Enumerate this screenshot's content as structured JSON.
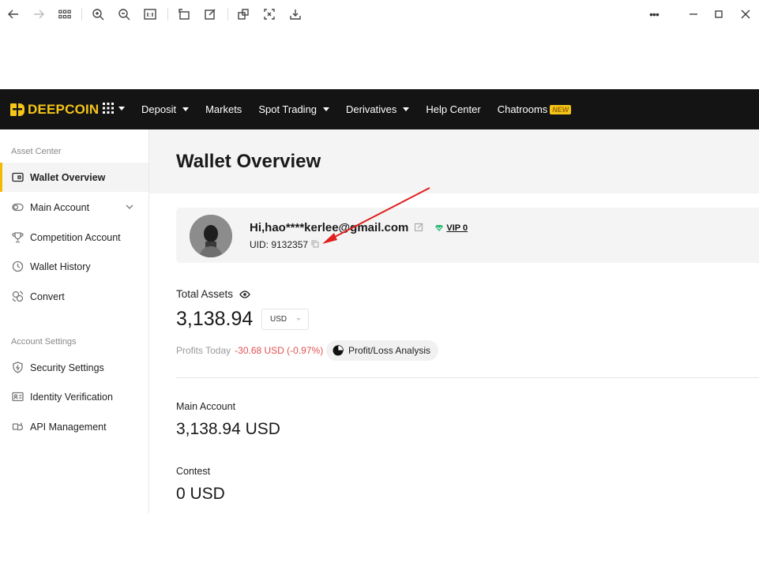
{
  "viewer": {
    "icons": [
      "back-icon",
      "forward-icon",
      "grid-icon",
      "zoom-in-icon",
      "zoom-out-icon",
      "actual-size-icon",
      "rotate-icon",
      "edit-icon",
      "crop-icon",
      "fullscreen-icon",
      "save-icon"
    ],
    "more_label": "•••"
  },
  "brand": {
    "name": "DEEPCOIN",
    "color": "#f5c518"
  },
  "nav": {
    "items": [
      {
        "label": "Deposit",
        "dropdown": true
      },
      {
        "label": "Markets",
        "dropdown": false
      },
      {
        "label": "Spot Trading",
        "dropdown": true
      },
      {
        "label": "Derivatives",
        "dropdown": true
      },
      {
        "label": "Help Center",
        "dropdown": false
      },
      {
        "label": "Chatrooms",
        "dropdown": false
      }
    ],
    "new_badge": "NEW"
  },
  "sidebar": {
    "section1": "Asset Center",
    "items1": [
      {
        "label": "Wallet Overview",
        "icon": "wallet-icon",
        "active": true
      },
      {
        "label": "Main Account",
        "icon": "toggle-icon",
        "active": false
      },
      {
        "label": "Competition Account",
        "icon": "trophy-icon",
        "active": false
      },
      {
        "label": "Wallet History",
        "icon": "clock-icon",
        "active": false
      },
      {
        "label": "Convert",
        "icon": "convert-icon",
        "active": false
      }
    ],
    "section2": "Account Settings",
    "items2": [
      {
        "label": "Security Settings",
        "icon": "shield-icon"
      },
      {
        "label": "Identity Verification",
        "icon": "id-card-icon"
      },
      {
        "label": "API Management",
        "icon": "api-icon"
      }
    ]
  },
  "main": {
    "title": "Wallet Overview",
    "greeting": "Hi,hao****kerlee@gmail.com",
    "vip": "VIP 0",
    "uid": "UID: 9132357",
    "total_assets_label": "Total Assets",
    "total_assets_value": "3,138.94",
    "currency": "USD",
    "profits_label": "Profits Today",
    "profits_value": "-30.68 USD (-0.97%)",
    "pl_button": "Profit/Loss Analysis",
    "accounts": [
      {
        "label": "Main Account",
        "value": "3,138.94 USD"
      },
      {
        "label": "Contest",
        "value": "0 USD"
      }
    ]
  },
  "colors": {
    "accent": "#f5b800",
    "negative": "#e25050",
    "nav_bg": "#141414",
    "annotation_arrow": "#e0201e"
  }
}
